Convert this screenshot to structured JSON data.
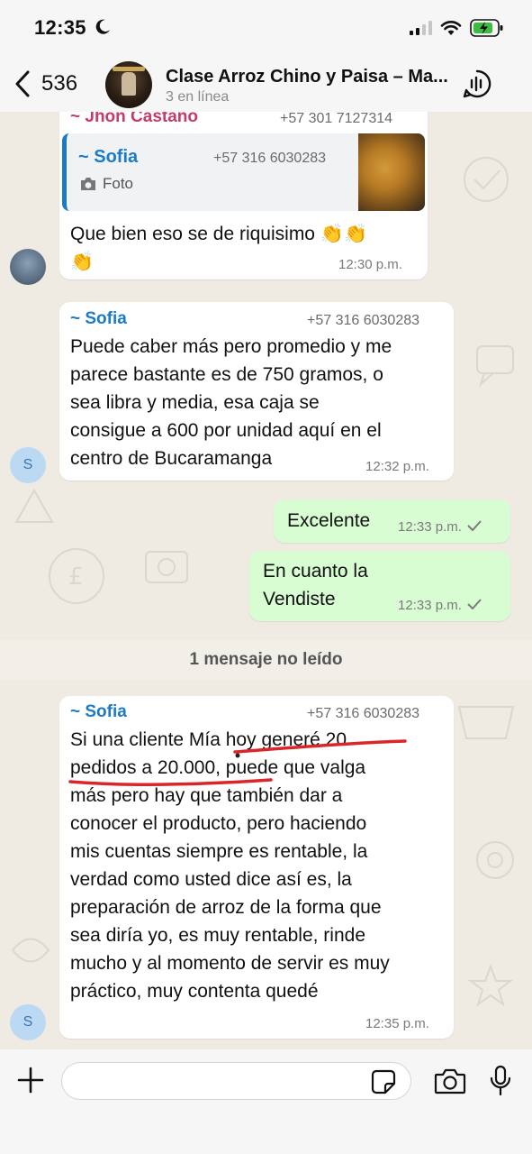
{
  "status_bar": {
    "time": "12:35"
  },
  "header": {
    "back_count": "536",
    "title": "Clase Arroz Chino y Paisa – Ma...",
    "subtitle": "3 en línea"
  },
  "messages": {
    "m1": {
      "sender": "~ Jhon Castaño",
      "phone": "+57 301 7127314",
      "quote_sender": "~ Sofia",
      "quote_phone": "+57 316 6030283",
      "quote_type": "Foto",
      "lines": [
        "Que bien eso se de riquisimo 👏👏",
        "👏"
      ],
      "time": "12:30 p.m."
    },
    "m2": {
      "sender": "~ Sofia",
      "phone": "+57 316 6030283",
      "lines": [
        "Puede caber más pero promedio y me",
        "parece bastante es de 750 gramos, o",
        "sea libra y media, esa caja se",
        "consigue a 600 por unidad aquí en el",
        "centro de Bucaramanga"
      ],
      "time": "12:32 p.m.",
      "avatar_initial": "S"
    },
    "m3": {
      "text": "Excelente",
      "time": "12:33 p.m."
    },
    "m4": {
      "lines": [
        "En cuanto la",
        "Vendiste"
      ],
      "time": "12:33 p.m."
    },
    "unread": "1 mensaje no leído",
    "m5": {
      "sender": "~ Sofia",
      "phone": "+57 316 6030283",
      "lines": [
        "Si una cliente Mía hoy generé 20",
        "pedidos a 20.000, puede que valga",
        "más pero hay que también dar a",
        "conocer el producto, pero haciendo",
        "mis cuentas siempre es rentable, la",
        "verdad como usted dice así es, la",
        "preparación de arroz de la forma que",
        "sea diría yo, es muy rentable, rinde",
        "mucho y al momento de servir es muy",
        "práctico, muy contenta quedé"
      ],
      "time": "12:35 p.m.",
      "avatar_initial": "S"
    }
  },
  "colors": {
    "accent": "#1c7bc7",
    "outgoing_bubble": "#d9fdd3",
    "incoming_bubble": "#ffffff",
    "chat_background": "#efeae2",
    "annotation_red": "#d8262a"
  },
  "input": {
    "placeholder": ""
  }
}
